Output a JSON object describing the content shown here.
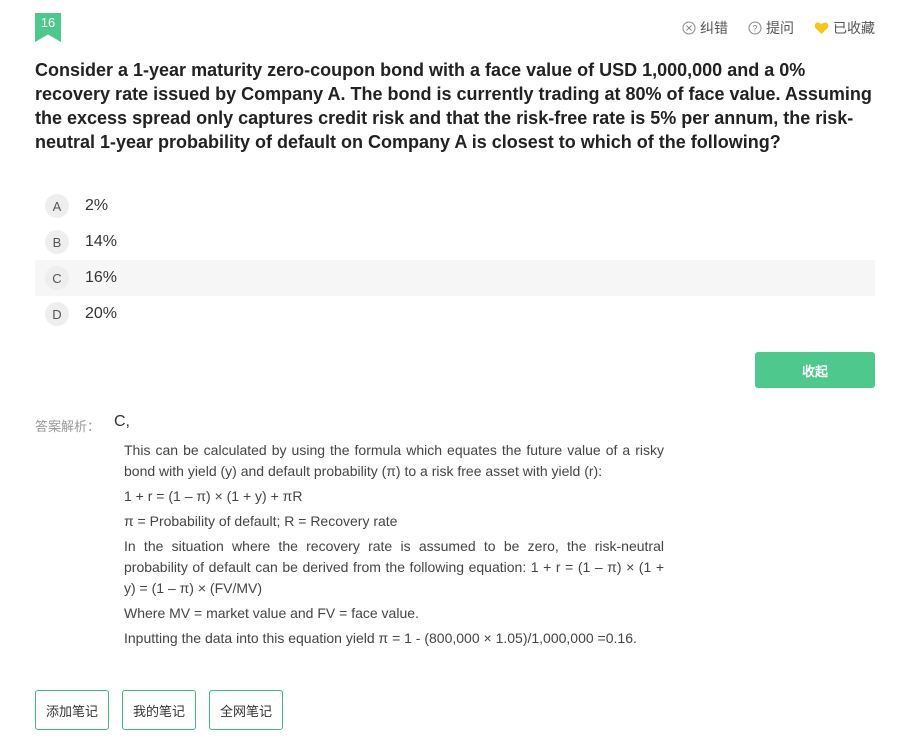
{
  "question": {
    "number": "16",
    "text": "Consider a 1-year maturity zero-coupon bond with a face value of USD 1,000,000 and a 0% recovery rate issued by Company A. The bond is currently trading at 80% of face value. Assuming the excess spread only captures credit risk and that the risk-free rate is 5% per annum, the risk-neutral 1-year probability of default on Company A is closest to which of the following?"
  },
  "toolbar": {
    "report_label": "纠错",
    "ask_label": "提问",
    "fav_label": "已收藏"
  },
  "options": [
    {
      "letter": "A",
      "text": "2%"
    },
    {
      "letter": "B",
      "text": "14%"
    },
    {
      "letter": "C",
      "text": "16%"
    },
    {
      "letter": "D",
      "text": "20%"
    }
  ],
  "collapse_label": "收起",
  "answer": {
    "label": "答案解析：",
    "value": "C,"
  },
  "explanation": [
    "This can be calculated by using the formula which equates the future value of a risky bond with yield (y) and default probability (π) to a risk free asset with yield (r):",
    "1 + r = (1 – π) × (1 + y) + πR",
    "π = Probability of default; R = Recovery rate",
    "In the situation where the recovery rate is assumed to be zero, the risk-neutral probability of default can be derived from the following equation: 1 + r = (1 – π) × (1 + y) = (1 – π) × (FV/MV)",
    "Where MV = market value and FV = face value.",
    "Inputting the data into this equation yield π = 1 - (800,000 × 1.05)/1,000,000 =0.16."
  ],
  "notes": {
    "add_label": "添加笔记",
    "mine_label": "我的笔记",
    "all_label": "全网笔记"
  },
  "colors": {
    "accent": "#4ec88d",
    "favorite": "#f5c518"
  }
}
